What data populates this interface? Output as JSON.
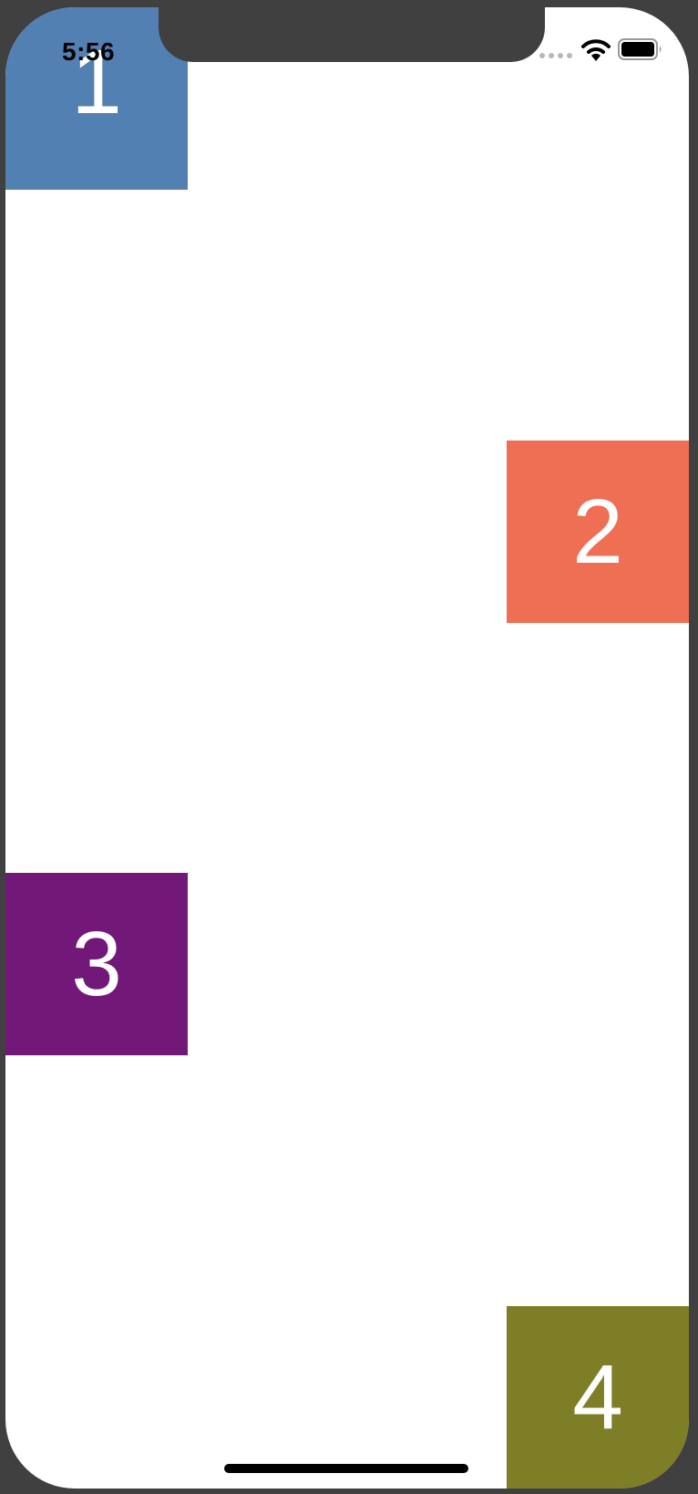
{
  "status_bar": {
    "time": "5:56",
    "icons": [
      "cellular-signal-icon",
      "wifi-icon",
      "battery-icon"
    ]
  },
  "tiles": [
    {
      "label": "1",
      "color": "#5380B2"
    },
    {
      "label": "2",
      "color": "#EE6F53"
    },
    {
      "label": "3",
      "color": "#711878"
    },
    {
      "label": "4",
      "color": "#7E7E27"
    }
  ],
  "colors": {
    "device_frame": "#404040",
    "screen_background": "#FFFFFF",
    "tile_text": "#FFFFFF"
  }
}
